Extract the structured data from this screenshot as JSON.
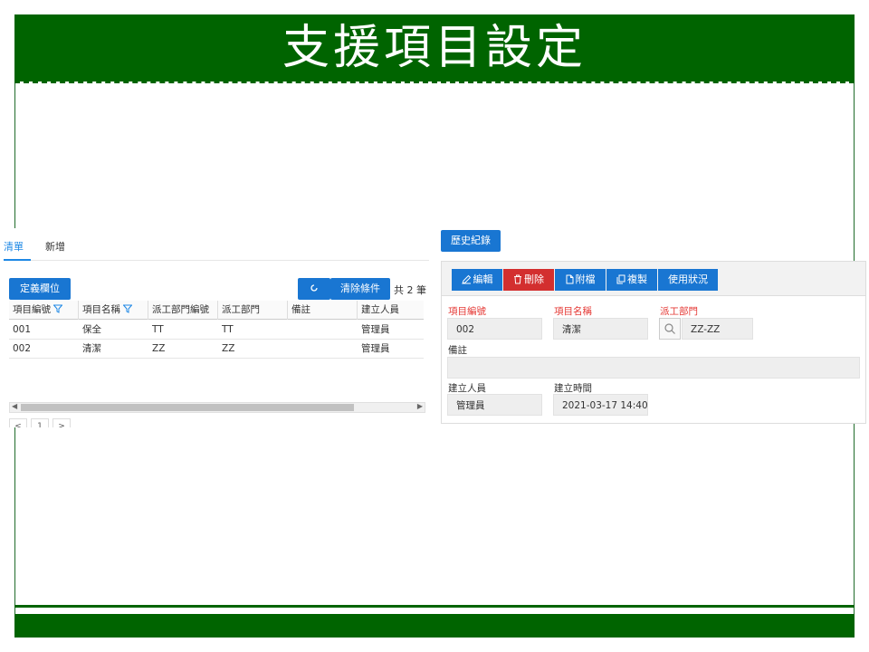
{
  "slide": {
    "title": "支援項目設定"
  },
  "colors": {
    "slide_green": "#006400",
    "primary": "#1976d2",
    "danger": "#d32f2f",
    "required_label": "#e53935"
  },
  "left": {
    "tabs": [
      {
        "label": "清單",
        "active": true
      },
      {
        "label": "新增",
        "active": false
      }
    ],
    "define_button": "定義欄位",
    "refresh_icon": "refresh-icon",
    "clear_button": "清除條件",
    "count_text": "共 2 筆",
    "table": {
      "columns": [
        "項目編號",
        "項目名稱",
        "派工部門編號",
        "派工部門",
        "備註",
        "建立人員"
      ],
      "rows": [
        [
          "001",
          "保全",
          "TT",
          "TT",
          "",
          "管理員"
        ],
        [
          "002",
          "清潔",
          "ZZ",
          "ZZ",
          "",
          "管理員"
        ]
      ]
    },
    "pager": {
      "prev": "<",
      "page": "1",
      "next": ">"
    }
  },
  "right": {
    "history_button": "歷史紀錄",
    "toolbar": {
      "edit": "編輯",
      "delete": "刪除",
      "attach": "附檔",
      "copy": "複製",
      "usage": "使用狀況"
    },
    "fields": {
      "item_no": {
        "label": "項目編號",
        "value": "002"
      },
      "item_name": {
        "label": "項目名稱",
        "value": "清潔"
      },
      "dept": {
        "label": "派工部門",
        "value": "ZZ-ZZ"
      },
      "note": {
        "label": "備註",
        "value": ""
      },
      "creator": {
        "label": "建立人員",
        "value": "管理員"
      },
      "created_at": {
        "label": "建立時間",
        "value": "2021-03-17 14:40:"
      }
    }
  }
}
